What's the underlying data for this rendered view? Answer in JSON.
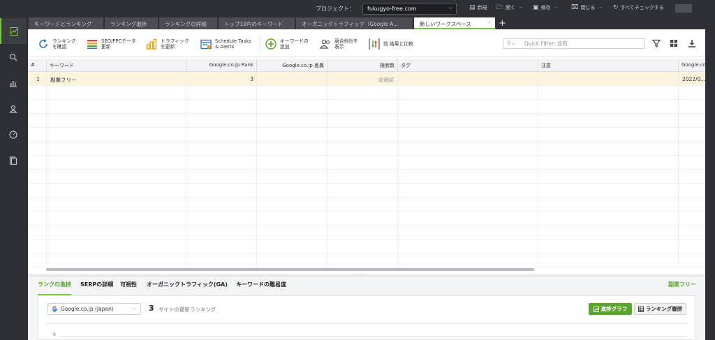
{
  "topbar": {
    "project_label": "プロジェクト：",
    "project_value": "fukugyo-free.com",
    "new_label": "新規",
    "open_label": "開く",
    "save_label": "保存",
    "close_label": "閉じる",
    "check_all_label": "すべてチェックする"
  },
  "tabs": [
    {
      "label": "キーワードとランキング"
    },
    {
      "label": "ランキング進捗"
    },
    {
      "label": "ランキングの詳細"
    },
    {
      "label": "トップ10内のキーワード"
    },
    {
      "label": "オーガニックトラフィック（Google A..."
    },
    {
      "label": "新しいワークスペース"
    }
  ],
  "tab_add_label": "+",
  "toolbar": {
    "check_rankings": "ランキング\nを確認",
    "update_seo": "SEO/PPCデータ\n更新",
    "update_traffic": "トラフィック\nを更新",
    "schedule_tasks": "Schedule Tasks\n& Alerts",
    "add_keyword": "キーワードの\n追加",
    "show_competitors": "競合他社を\n表示",
    "compare_prev": "前 結果と比較",
    "quick_filter_placeholder": "Quick Filter: 含有"
  },
  "grid": {
    "headers": [
      "#",
      "キーワード",
      "Google.co.jp Rank",
      "Google.co.jp 差異",
      "検索数",
      "タグ",
      "注意",
      "Google.co..."
    ],
    "rows": [
      {
        "num": "1",
        "keyword": "副業フリー",
        "rank": "3",
        "diff": "",
        "volume": "未確認",
        "tag": "",
        "note": "",
        "date": "2022/0..."
      }
    ]
  },
  "bottom": {
    "tabs": [
      "ランクの進捗",
      "SERPの詳細",
      "可視性",
      "オーガニックトラフィック(GA)",
      "キーワードの難易度"
    ],
    "selected_keyword": "副業フリー",
    "engine": "Google.co.jp (Japan)",
    "rank_value": "3",
    "rank_caption": "サイトの最新ランキング",
    "progress_graph_label": "進捗グラフ",
    "ranking_history_label": "ランキング履歴",
    "chart_y_tick": "0"
  },
  "colors": {
    "accent": "#7ec247",
    "accent_dark": "#5aa52e",
    "chrome": "#2d3034",
    "selected_row": "#fbf4dc"
  },
  "icons": {
    "sidebar": [
      "trend-chart-icon",
      "search-icon",
      "bar-chart-icon",
      "user-icon",
      "gauge-icon",
      "report-icon"
    ]
  }
}
